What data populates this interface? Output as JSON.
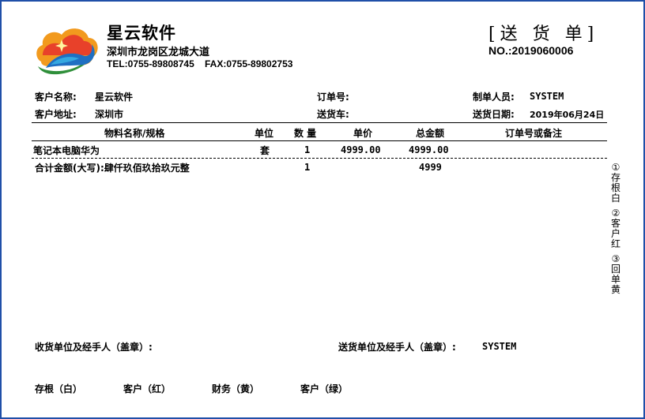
{
  "header": {
    "company_name": "星云软件",
    "company_address": "深圳市龙岗区龙城大道",
    "tel": "TEL:0755-89808745",
    "fax": "FAX:0755-89802753",
    "doc_title": "[送 货 单]",
    "doc_no": "NO.:2019060006"
  },
  "info": {
    "customer_name_label": "客户名称:",
    "customer_name": "星云软件",
    "order_no_label": "订单号:",
    "order_no": "",
    "creator_label": "制单人员:",
    "creator": "SYSTEM",
    "customer_address_label": "客户地址:",
    "customer_address": "深圳市",
    "delivery_vehicle_label": "送货车:",
    "delivery_vehicle": "",
    "delivery_date_label": "送货日期:",
    "delivery_date": "2019年06月24日"
  },
  "table": {
    "headers": {
      "item": "物料名称/规格",
      "unit": "单位",
      "qty": "数 量",
      "price": "单价",
      "amount": "总金额",
      "note": "订单号或备注"
    },
    "rows": [
      {
        "item": "笔记本电脑华为",
        "unit": "套",
        "qty": "1",
        "price": "4999.00",
        "amount": "4999.00",
        "note": ""
      }
    ],
    "total": {
      "label": "合计金额(大写):肆仟玖佰玖拾玖元整",
      "qty": "1",
      "amount": "4999"
    }
  },
  "side_copies": [
    "①存根白",
    "②客户红",
    "③回单黄"
  ],
  "footer": {
    "receiver_label": "收货单位及经手人（盖章）:",
    "sender_label": "送货单位及经手人（盖章）:",
    "sender_value": "SYSTEM",
    "copies": [
      "存根（白）",
      "客户（红）",
      "财务（黄）",
      "客户（绿）"
    ]
  }
}
